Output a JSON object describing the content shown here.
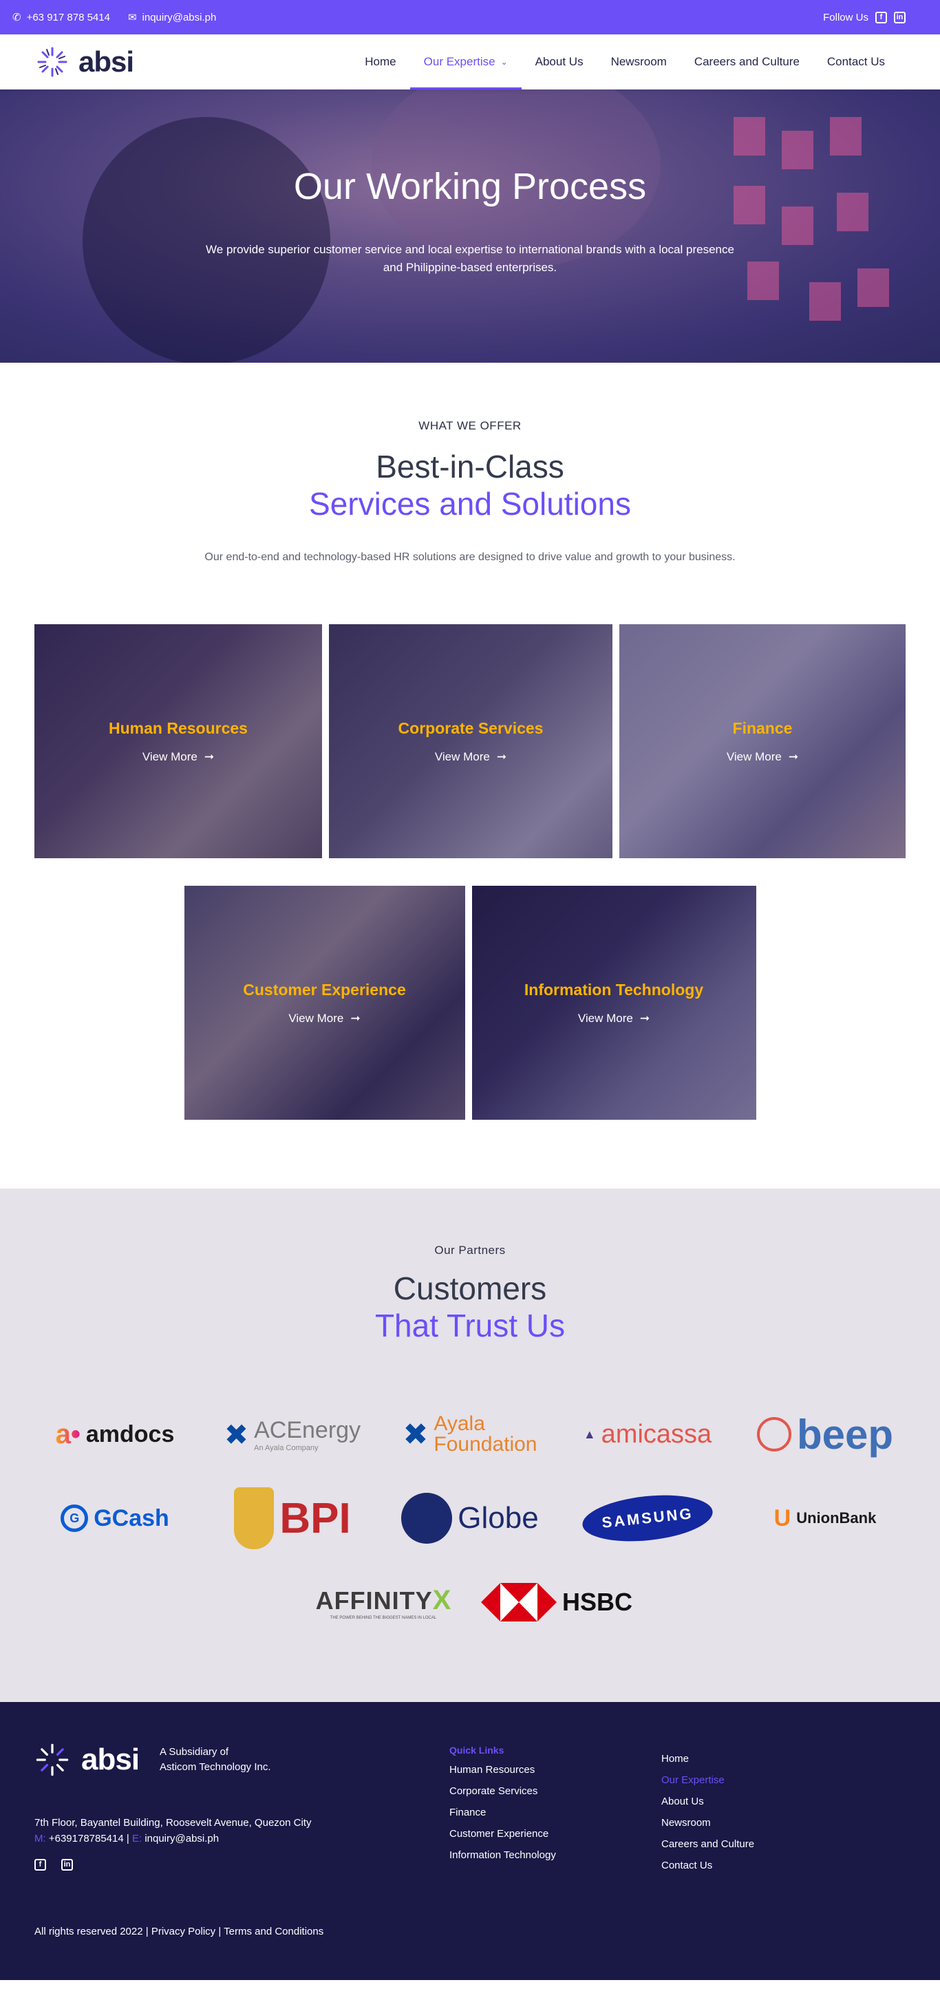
{
  "topbar": {
    "phone": "+63 917 878 5414",
    "email": "inquiry@absi.ph",
    "follow_label": "Follow Us"
  },
  "brand": {
    "name": "absi"
  },
  "nav": {
    "items": [
      "Home",
      "Our Expertise",
      "About Us",
      "Newsroom",
      "Careers and Culture",
      "Contact Us"
    ],
    "active": "Our Expertise"
  },
  "hero": {
    "title": "Our Working Process",
    "text": "We provide superior customer service and local expertise to international brands with a local presence and Philippine-based enterprises."
  },
  "offer": {
    "eyebrow": "WHAT WE OFFER",
    "title_line1": "Best-in-Class",
    "title_line2": "Services and Solutions",
    "lead": "Our end-to-end and technology-based HR solutions are designed to drive value and growth to your business.",
    "more_label": "View More",
    "cards": [
      {
        "title": "Human Resources"
      },
      {
        "title": "Corporate Services"
      },
      {
        "title": "Finance"
      },
      {
        "title": "Customer Experience"
      },
      {
        "title": "Information Technology"
      }
    ]
  },
  "partners": {
    "eyebrow": "Our Partners",
    "title_line1": "Customers",
    "title_line2": "That Trust Us",
    "logos": {
      "amdocs": "amdocs",
      "acen": "ACEnergy",
      "acen_sub": "An Ayala Company",
      "ayala_1": "Ayala",
      "ayala_2": "Foundation",
      "amicassa": "amicassa",
      "beep": "beep",
      "gcash": "GCash",
      "bpi": "BPI",
      "globe": "Globe",
      "samsung": "SAMSUNG",
      "unionbank": "UnionBank",
      "affinity": "AFFINITY",
      "affinity_sub": "THE POWER BEHIND THE BIGGEST NAMES IN LOCAL",
      "hsbc": "HSBC"
    }
  },
  "footer": {
    "subsidiary_1": "A Subsidiary of",
    "subsidiary_2": "Asticom Technology Inc.",
    "address": "7th Floor, Bayantel Building, Roosevelt Avenue, Quezon City",
    "mobile_label": "M:",
    "mobile": "+639178785414",
    "email_label": "E:",
    "email": "inquiry@absi.ph",
    "quick_links_head": "Quick Links",
    "quick_links": [
      "Human Resources",
      "Corporate Services",
      "Finance",
      "Customer Experience",
      "Information Technology"
    ],
    "nav_links": [
      "Home",
      "Our Expertise",
      "About Us",
      "Newsroom",
      "Careers and Culture",
      "Contact Us"
    ],
    "copyright": "All rights reserved 2022",
    "privacy": "Privacy Policy",
    "terms": "Terms and Conditions"
  },
  "colors": {
    "accent": "#6c4ff7",
    "highlight": "#ffb400",
    "footer_bg": "#1a1845",
    "partners_bg": "#e6e2e9"
  }
}
